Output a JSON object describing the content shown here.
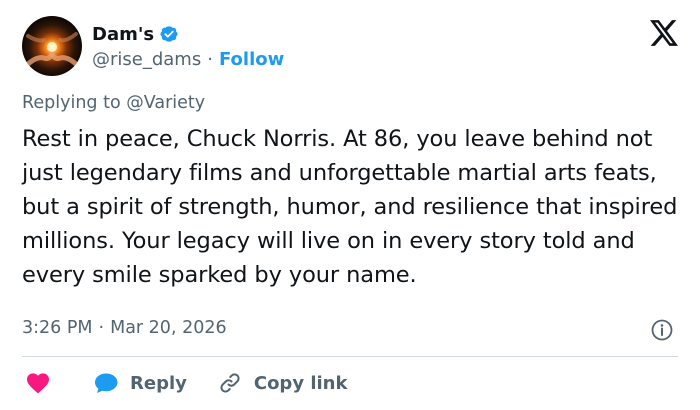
{
  "colors": {
    "accent": "#1d9bf0",
    "text": "#0f1419",
    "muted": "#536471",
    "like": "#f91880",
    "divider": "#cfd9de"
  },
  "author": {
    "name": "Dam's",
    "handle": "@rise_dams",
    "separator": "·",
    "follow_label": "Follow",
    "verified_icon": "verified-badge-icon",
    "avatar_icon": "avatar-image"
  },
  "reply": {
    "prefix": "Replying to",
    "handle": "@Variety"
  },
  "tweet": {
    "text": "Rest in peace, Chuck Norris. At 86, you leave behind not just legendary films and unforgettable martial arts feats, but a spirit of strength, humor, and resilience that inspired millions. Your legacy will live on in every story told and every smile sparked by your name.",
    "time": "3:26 PM",
    "separator": "·",
    "date": "Mar 20, 2026"
  },
  "actions": {
    "like_icon": "heart-icon",
    "reply_icon": "reply-bubble-icon",
    "reply_label": "Reply",
    "copy_icon": "link-icon",
    "copy_label": "Copy link",
    "info_icon": "info-icon",
    "brand_icon": "x-logo-icon"
  }
}
